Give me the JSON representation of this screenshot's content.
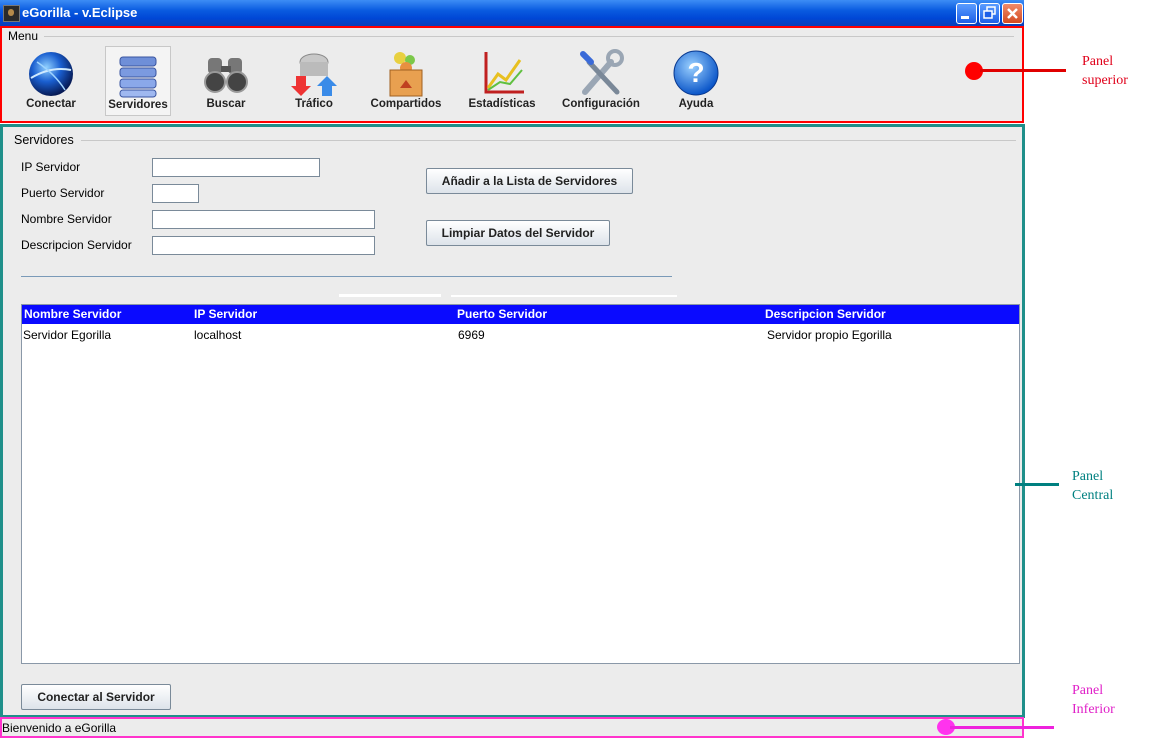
{
  "window": {
    "title": "eGorilla - v.Eclipse"
  },
  "menu": {
    "title": "Menu",
    "items": [
      {
        "label": "Conectar",
        "icon": "globe-icon"
      },
      {
        "label": "Servidores",
        "icon": "server-stack-icon"
      },
      {
        "label": "Buscar",
        "icon": "binoculars-icon"
      },
      {
        "label": "Tráfico",
        "icon": "traffic-arrows-icon"
      },
      {
        "label": "Compartidos",
        "icon": "shared-box-icon"
      },
      {
        "label": "Estadísticas",
        "icon": "line-chart-icon"
      },
      {
        "label": "Configuración",
        "icon": "tools-icon"
      },
      {
        "label": "Ayuda",
        "icon": "help-icon"
      }
    ],
    "selected": "Servidores"
  },
  "servers": {
    "section_title": "Servidores",
    "fields": {
      "ip_label": "IP Servidor",
      "ip_value": "",
      "port_label": "Puerto Servidor",
      "port_value": "",
      "name_label": "Nombre Servidor",
      "name_value": "",
      "desc_label": "Descripcion Servidor",
      "desc_value": ""
    },
    "add_button": "Añadir a la Lista de Servidores",
    "clear_button": "Limpiar Datos del Servidor",
    "table": {
      "headers": [
        "Nombre Servidor",
        "IP Servidor",
        "Puerto Servidor",
        "Descripcion Servidor"
      ],
      "rows": [
        [
          "Servidor Egorilla",
          "localhost",
          "6969",
          "Servidor propio Egorilla"
        ]
      ]
    },
    "connect_button": "Conectar al Servidor"
  },
  "status": {
    "text": "Bienvenido a eGorilla"
  },
  "annotations": {
    "top": [
      "Panel",
      "superior"
    ],
    "central": [
      "Panel",
      "Central"
    ],
    "bottom": [
      "Panel",
      "Inferior"
    ]
  },
  "colors": {
    "top_panel_border": "#ff0000",
    "central_panel_border": "#1f8f8a",
    "bottom_panel_border": "#ff33cc",
    "table_header": "#0a0aff"
  }
}
